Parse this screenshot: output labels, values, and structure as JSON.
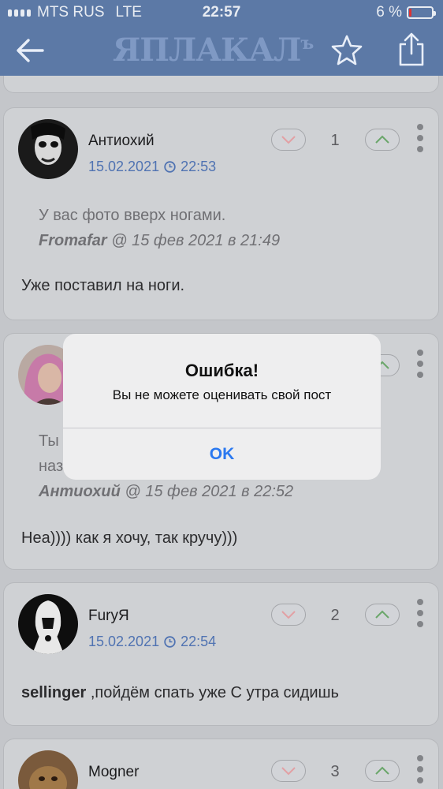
{
  "status_bar": {
    "carrier": "MTS RUS",
    "network": "LTE",
    "time": "22:57",
    "battery_text": "6 %",
    "battery_level": 0.06
  },
  "nav": {
    "logo_text": "ЯПЛАКАЛ",
    "logo_suffix": "ъ",
    "back_icon": "back-arrow-icon",
    "favorite_icon": "star-icon",
    "share_icon": "share-icon"
  },
  "comments": [
    {
      "author": "Антиохий",
      "date": "15.02.2021",
      "time": "22:53",
      "rating": "1",
      "quote_text": "У вас фото вверх ногами.",
      "quote_author": "Fromafar",
      "quote_meta": " @ 15 фев 2021 в 21:49",
      "body": "Уже поставил на ноги."
    },
    {
      "quote_text_line1": "Ты",
      "quote_text_line2": "наз",
      "quote_author": "Антиохий",
      "quote_meta": " @ 15 фев 2021 в 22:52",
      "body": "Неа)))) как я хочу, так кручу)))"
    },
    {
      "author": "FuryЯ",
      "date": "15.02.2021",
      "time": "22:54",
      "rating": "2",
      "body_bold": "sellinger",
      "body": " ,пойдём спать уже  С утра сидишь"
    },
    {
      "author": "Mogner",
      "rating": "3"
    }
  ],
  "dialog": {
    "title": "Ошибка!",
    "message": "Вы не можете оценивать свой пост",
    "ok_label": "OK"
  },
  "colors": {
    "nav_bg": "#5c79a6",
    "link_blue": "#5073b2",
    "ok_blue": "#2a78f0"
  }
}
